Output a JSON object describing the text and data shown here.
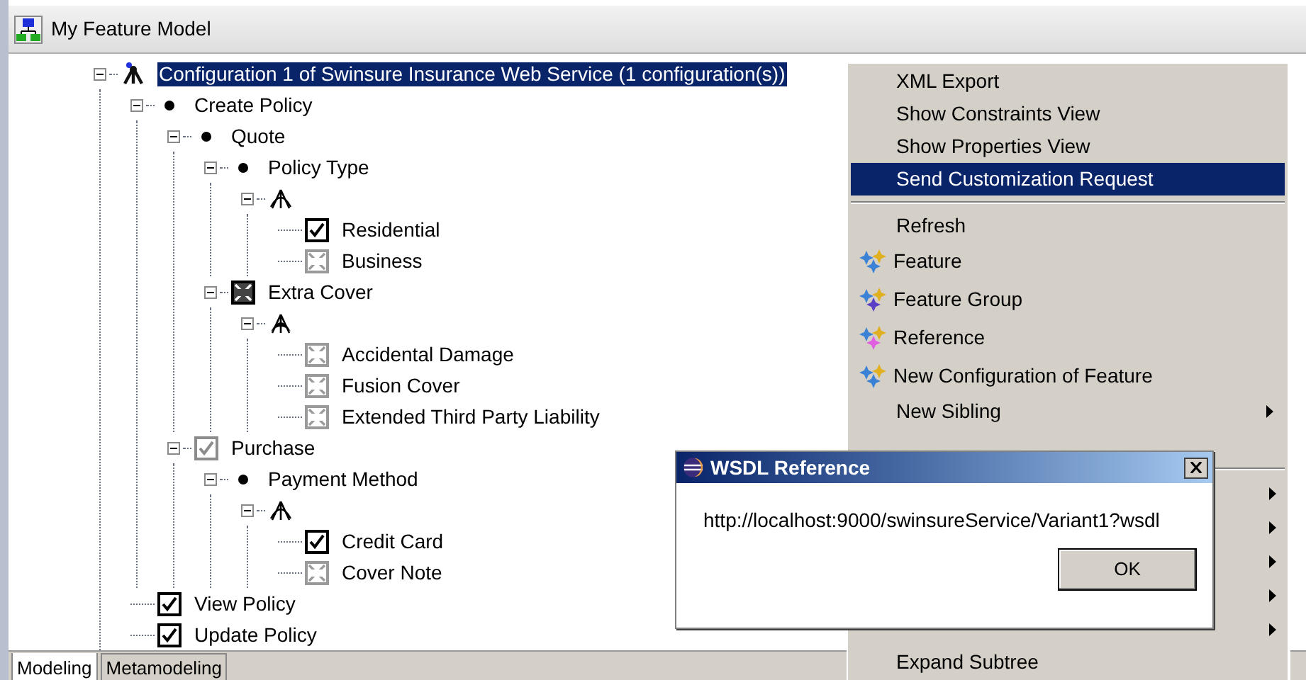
{
  "editor": {
    "title": "My Feature Model"
  },
  "tree": [
    {
      "label": "Configuration 1 of Swinsure Insurance Web Service (1 configuration(s))",
      "kind": "config",
      "selected": true,
      "expanded": true,
      "children": [
        {
          "label": "Create Policy",
          "kind": "mandatory",
          "selected": false,
          "expanded": true,
          "children": [
            {
              "label": "Quote",
              "kind": "mandatory",
              "selected": false,
              "expanded": true,
              "children": [
                {
                  "label": "Policy Type",
                  "kind": "mandatory",
                  "selected": false,
                  "expanded": true,
                  "children": [
                    {
                      "kind": "group-alt",
                      "expanded": true,
                      "children": [
                        {
                          "label": "Residential",
                          "kind": "checked",
                          "selected": false
                        },
                        {
                          "label": "Business",
                          "kind": "unchecked",
                          "selected": false
                        }
                      ]
                    }
                  ]
                },
                {
                  "label": "Extra Cover",
                  "kind": "excluded",
                  "selected": false,
                  "expanded": true,
                  "children": [
                    {
                      "kind": "group-or",
                      "expanded": true,
                      "children": [
                        {
                          "label": "Accidental Damage",
                          "kind": "unchecked",
                          "selected": false
                        },
                        {
                          "label": "Fusion Cover",
                          "kind": "unchecked",
                          "selected": false
                        },
                        {
                          "label": "Extended Third Party Liability",
                          "kind": "unchecked",
                          "selected": false
                        }
                      ]
                    }
                  ]
                }
              ]
            },
            {
              "label": "Purchase",
              "kind": "implied",
              "selected": false,
              "expanded": true,
              "children": [
                {
                  "label": "Payment Method",
                  "kind": "mandatory",
                  "selected": false,
                  "expanded": true,
                  "children": [
                    {
                      "kind": "group-alt",
                      "expanded": true,
                      "children": [
                        {
                          "label": "Credit Card",
                          "kind": "checked",
                          "selected": false
                        },
                        {
                          "label": "Cover Note",
                          "kind": "unchecked",
                          "selected": false
                        }
                      ]
                    }
                  ]
                }
              ]
            }
          ]
        },
        {
          "label": "View Policy",
          "kind": "checked",
          "selected": false
        },
        {
          "label": "Update Policy",
          "kind": "checked",
          "selected": false
        }
      ]
    }
  ],
  "tabs": [
    {
      "label": "Modeling",
      "selected": true
    },
    {
      "label": "Metamodeling",
      "selected": false
    }
  ],
  "context_menu": [
    {
      "kind": "item",
      "label": "XML Export",
      "selected": false,
      "submenu": false
    },
    {
      "kind": "item",
      "label": "Show Constraints View",
      "selected": false,
      "submenu": false
    },
    {
      "kind": "item",
      "label": "Show Properties View",
      "selected": false,
      "submenu": false
    },
    {
      "kind": "item",
      "label": "Send Customization Request",
      "selected": true,
      "submenu": false
    },
    {
      "kind": "separator"
    },
    {
      "kind": "item",
      "label": "Refresh",
      "selected": false,
      "submenu": false
    },
    {
      "kind": "icon-item",
      "label": "Feature",
      "color": "#3b82d6",
      "selected": false,
      "submenu": false
    },
    {
      "kind": "icon-item",
      "label": "Feature Group",
      "color": "#5b3fc4",
      "selected": false,
      "submenu": false
    },
    {
      "kind": "icon-item",
      "label": "Reference",
      "color": "#e05ee0",
      "selected": false,
      "submenu": false
    },
    {
      "kind": "icon-item",
      "label": "New Configuration of Feature",
      "color": "#3b82d6",
      "selected": false,
      "submenu": false
    },
    {
      "kind": "item",
      "label": "New Sibling",
      "selected": false,
      "submenu": true
    },
    {
      "kind": "hidden"
    },
    {
      "kind": "separator"
    },
    {
      "kind": "hidden",
      "submenu": true
    },
    {
      "kind": "hidden",
      "submenu": true
    },
    {
      "kind": "hidden",
      "submenu": true
    },
    {
      "kind": "hidden",
      "submenu": true
    },
    {
      "kind": "hidden",
      "submenu": true
    },
    {
      "kind": "item",
      "label": "Expand Subtree",
      "selected": false,
      "submenu": false
    }
  ],
  "dialog": {
    "title": "WSDL Reference",
    "message": "http://localhost:9000/swinsureService/Variant1?wsdl",
    "button": "OK"
  }
}
